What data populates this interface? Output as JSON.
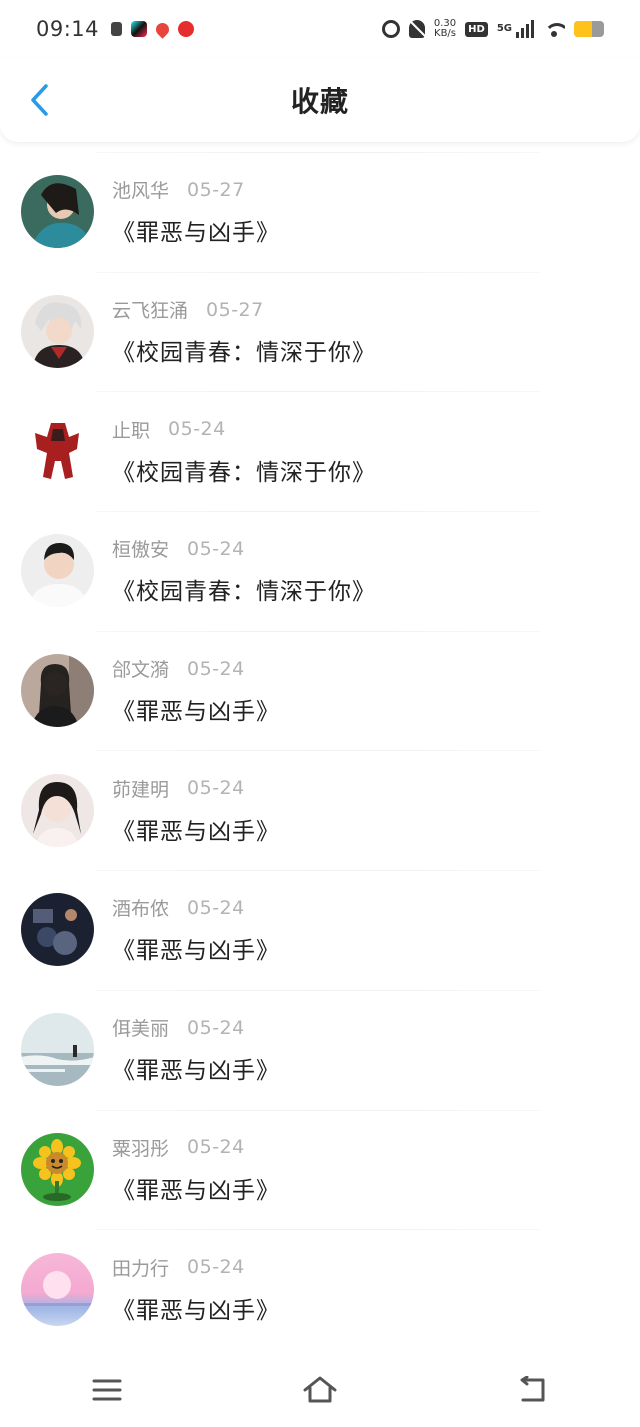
{
  "status_bar": {
    "time": "09:14",
    "net_speed": "0.30",
    "net_speed_unit": "KB/s",
    "hd_label": "HD",
    "network_label": "5G",
    "battery_level": 0.6,
    "battery_color": "#ffc21a"
  },
  "header": {
    "title": "收藏",
    "back_icon": "chevron-left-icon",
    "accent_color": "#2b9ae6"
  },
  "favorites": [
    {
      "author": "池风华",
      "date": "05-27",
      "book": "《罪恶与凶手》",
      "avatar": "woman-portrait"
    },
    {
      "author": "云飞狂涌",
      "date": "05-27",
      "book": "《校园青春：情深于你》",
      "avatar": "anime-boy"
    },
    {
      "author": "止职",
      "date": "05-24",
      "book": "《校园青春：情深于你》",
      "avatar": "red-robot"
    },
    {
      "author": "桓傲安",
      "date": "05-24",
      "book": "《校园青春：情深于你》",
      "avatar": "man-portrait"
    },
    {
      "author": "郃文漪",
      "date": "05-24",
      "book": "《罪恶与凶手》",
      "avatar": "dark-girl"
    },
    {
      "author": "茆建明",
      "date": "05-24",
      "book": "《罪恶与凶手》",
      "avatar": "girl-selfie"
    },
    {
      "author": "酒布侬",
      "date": "05-24",
      "book": "《罪恶与凶手》",
      "avatar": "night-scene"
    },
    {
      "author": "佴美丽",
      "date": "05-24",
      "book": "《罪恶与凶手》",
      "avatar": "beach"
    },
    {
      "author": "粟羽彤",
      "date": "05-24",
      "book": "《罪恶与凶手》",
      "avatar": "sunflower"
    },
    {
      "author": "田力行",
      "date": "05-24",
      "book": "《罪恶与凶手》",
      "avatar": "pink-sunset"
    }
  ],
  "nav_bar": {
    "items": [
      "menu-icon",
      "home-icon",
      "back-icon"
    ]
  }
}
